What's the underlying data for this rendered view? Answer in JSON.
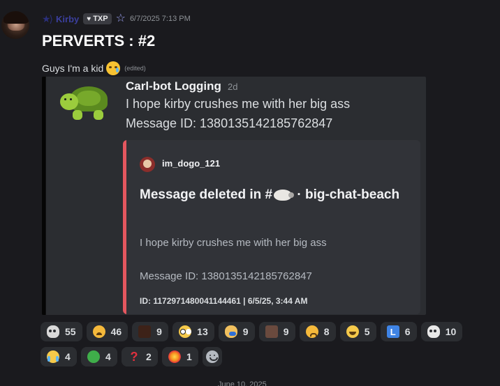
{
  "message": {
    "username": "Kirby",
    "clan_tag": "TXP",
    "timestamp": "6/7/2025 7:13 PM",
    "title": "PERVERTS : #2",
    "text": "Guys I'm a kid",
    "edited_label": "(edited)"
  },
  "embed": {
    "bot_name": "Carl-bot Logging",
    "bot_age": "2d",
    "line1": "I hope kirby crushes me with her big ass",
    "line2": "Message ID: 1380135142185762847",
    "log": {
      "user": "im_dogo_121",
      "title_prefix": "Message deleted in #",
      "title_suffix": "· big-chat-beach",
      "body": "I hope kirby crushes me with her big ass",
      "message_id": "Message ID: 1380135142185762847",
      "footer": "ID: 1172971480041144461 | 6/5/25, 3:44 AM"
    }
  },
  "reactions": {
    "row1": [
      {
        "icon": "skull-icon",
        "count": "55"
      },
      {
        "icon": "weary-face-icon",
        "count": "46"
      },
      {
        "icon": "custom-emoji-icon",
        "count": "9"
      },
      {
        "icon": "flushed-face-icon",
        "count": "13"
      },
      {
        "icon": "facepalm-icon",
        "count": "9"
      },
      {
        "icon": "custom-avatar-emoji-icon",
        "count": "9"
      },
      {
        "icon": "worried-face-icon",
        "count": "8"
      },
      {
        "icon": "joy-face-icon",
        "count": "5"
      },
      {
        "icon": "letter-l-icon",
        "count": "6"
      },
      {
        "icon": "skull-icon",
        "count": "10"
      }
    ],
    "row2": [
      {
        "icon": "sob-face-icon",
        "count": "4"
      },
      {
        "icon": "sick-face-icon",
        "count": "4"
      },
      {
        "icon": "question-mark-icon",
        "count": "2"
      },
      {
        "icon": "collision-icon",
        "count": "1"
      }
    ]
  },
  "divider": {
    "date": "June 10, 2025"
  },
  "colors": {
    "background": "#1a1a1e",
    "reaction_pill": "#2b2d31",
    "log_accent": "#e4575f",
    "username": "#3b3f9e"
  }
}
